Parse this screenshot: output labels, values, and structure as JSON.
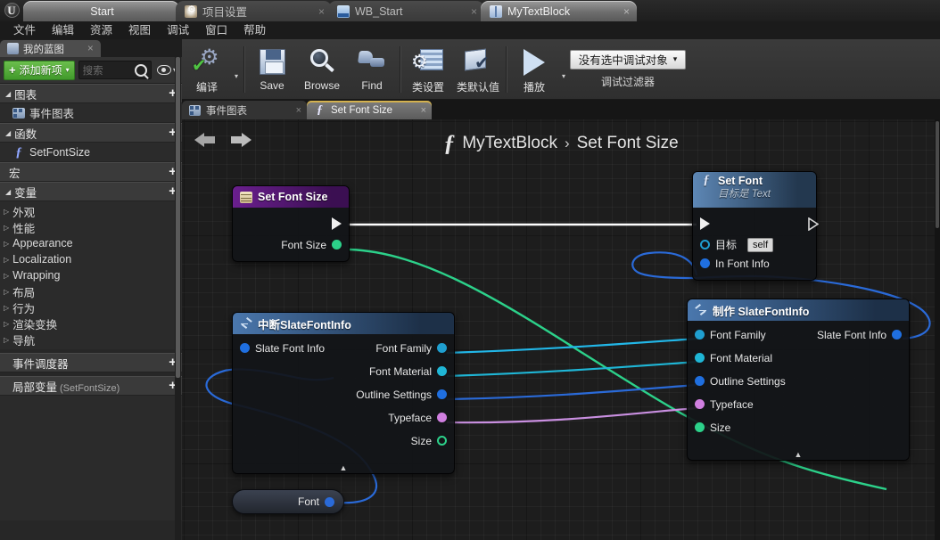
{
  "titlebar": {
    "logo": "unreal-logo",
    "tabs": [
      {
        "label": "Start",
        "icon": "none",
        "state": "active",
        "close": false
      },
      {
        "label": "项目设置",
        "icon": "gear-icon",
        "state": "dim",
        "close": true
      },
      {
        "label": "WB_Start",
        "icon": "widget-icon",
        "state": "dim",
        "close": true
      },
      {
        "label": "MyTextBlock",
        "icon": "blueprint-icon",
        "state": "active",
        "close": true
      }
    ],
    "close_glyph": "×"
  },
  "menubar": {
    "items": [
      "文件",
      "编辑",
      "资源",
      "视图",
      "调试",
      "窗口",
      "帮助"
    ]
  },
  "left_panel": {
    "tab": {
      "label": "我的蓝图",
      "icon": "blueprint-icon",
      "close": "×"
    },
    "add_new": {
      "label": "添加新项",
      "plus": "+",
      "caret": "▾"
    },
    "search": {
      "placeholder": "搜索",
      "icon": "search-icon"
    },
    "eye": {
      "icon": "eye-icon",
      "caret": "▾"
    },
    "sections": [
      {
        "label": "图表",
        "triangle": "◢",
        "plus": "+",
        "items": [
          {
            "label": "事件图表",
            "icon": "graph-icon"
          }
        ]
      },
      {
        "label": "函数",
        "triangle": "◢",
        "plus": "+",
        "items": [
          {
            "label": "SetFontSize",
            "icon": "function-icon"
          }
        ]
      },
      {
        "label": "宏",
        "triangle": "",
        "plus": "+",
        "items": []
      },
      {
        "label": "变量",
        "triangle": "◢",
        "plus": "+",
        "items": []
      }
    ],
    "variables": [
      {
        "label": "外观"
      },
      {
        "label": "性能"
      },
      {
        "label": "Appearance"
      },
      {
        "label": "Localization"
      },
      {
        "label": "Wrapping"
      },
      {
        "label": "布局"
      },
      {
        "label": "行为"
      },
      {
        "label": "渲染变换"
      },
      {
        "label": "导航"
      }
    ],
    "event_dispatcher": {
      "label": "事件调度器",
      "plus": "+"
    },
    "local_vars": {
      "label": "局部变量",
      "suffix": "(SetFontSize)",
      "plus": "+"
    }
  },
  "toolbar": {
    "items": [
      {
        "label": "编译",
        "icon": "compile-icon",
        "caret": "▾"
      },
      {
        "label": "Save",
        "icon": "save-icon"
      },
      {
        "label": "Browse",
        "icon": "browse-icon"
      },
      {
        "label": "Find",
        "icon": "find-icon"
      },
      {
        "label": "类设置",
        "icon": "class-settings-icon"
      },
      {
        "label": "类默认值",
        "icon": "class-defaults-icon"
      },
      {
        "label": "播放",
        "icon": "play-icon",
        "caret": "▾"
      }
    ],
    "debug": {
      "selected": "没有选中调试对象",
      "caret": "▾",
      "caption": "调试过滤器"
    }
  },
  "graph_tabs": [
    {
      "label": "事件图表",
      "icon": "graph-icon",
      "active": false,
      "close": "×"
    },
    {
      "label": "Set Font Size",
      "icon": "function-icon",
      "active": true,
      "close": "×"
    }
  ],
  "graph": {
    "nav": {
      "back": "back-arrow",
      "forward": "forward-arrow"
    },
    "breadcrumb": {
      "fn_icon": "function-icon",
      "owner": "MyTextBlock",
      "separator": "›",
      "current": "Set Font Size"
    },
    "nodes": [
      {
        "id": "set-font-size",
        "title": "Set Font Size",
        "subtitle": "",
        "icon": "set-variable-icon",
        "header_style": "purple",
        "inputs": [],
        "outputs": [
          {
            "label": "",
            "type": "exec"
          },
          {
            "label": "Font Size",
            "type": "float",
            "color": "#2cd18a"
          }
        ]
      },
      {
        "id": "set-font",
        "title": "Set Font",
        "subtitle": "目标是 Text",
        "icon": "function-icon",
        "header_style": "blue",
        "inputs": [
          {
            "label": "",
            "type": "exec"
          },
          {
            "label": "目标",
            "type": "object",
            "color": "#1f9fd0",
            "value": "self"
          },
          {
            "label": "In Font Info",
            "type": "struct",
            "color": "#1f6fe0"
          }
        ],
        "outputs": [
          {
            "label": "",
            "type": "exec"
          }
        ]
      },
      {
        "id": "break-slatefontinfo",
        "title": "中断SlateFontInfo",
        "icon": "break-struct-icon",
        "header_style": "blue",
        "inputs": [
          {
            "label": "Slate Font Info",
            "type": "struct",
            "color": "#1f6fe0"
          }
        ],
        "outputs": [
          {
            "label": "Font Family",
            "type": "object",
            "color": "#1f9fd0"
          },
          {
            "label": "Font Material",
            "type": "object",
            "color": "#1fb6d6"
          },
          {
            "label": "Outline Settings",
            "type": "struct",
            "color": "#1f6fe0"
          },
          {
            "label": "Typeface",
            "type": "name",
            "color": "#d07fe0"
          },
          {
            "label": "Size",
            "type": "float",
            "color": "#2cd18a"
          }
        ],
        "collapse": "▲"
      },
      {
        "id": "make-slatefontinfo",
        "title": "制作 SlateFontInfo",
        "icon": "make-struct-icon",
        "header_style": "blue",
        "inputs": [
          {
            "label": "Font Family",
            "type": "object",
            "color": "#1f9fd0"
          },
          {
            "label": "Font Material",
            "type": "object",
            "color": "#1fb6d6"
          },
          {
            "label": "Outline Settings",
            "type": "struct",
            "color": "#1f6fe0"
          },
          {
            "label": "Typeface",
            "type": "name",
            "color": "#d07fe0"
          },
          {
            "label": "Size",
            "type": "float",
            "color": "#2cd18a"
          }
        ],
        "outputs": [
          {
            "label": "Slate Font Info",
            "type": "struct",
            "color": "#1f6fe0"
          }
        ],
        "collapse": "▲"
      },
      {
        "id": "font-reroute",
        "title": "Font",
        "header_style": "reroute",
        "outputs": [
          {
            "label": "Font",
            "type": "struct",
            "color": "#1f6fe0"
          }
        ]
      }
    ]
  },
  "colors": {
    "exec_wire": "#ffffff",
    "float_wire": "#2cd18a",
    "struct_wire": "#2a6ad8",
    "object_wire": "#22b7e8",
    "name_wire": "#c98fe0",
    "accent_green": "#4fc442",
    "tab_accent": "#d3b14e"
  }
}
